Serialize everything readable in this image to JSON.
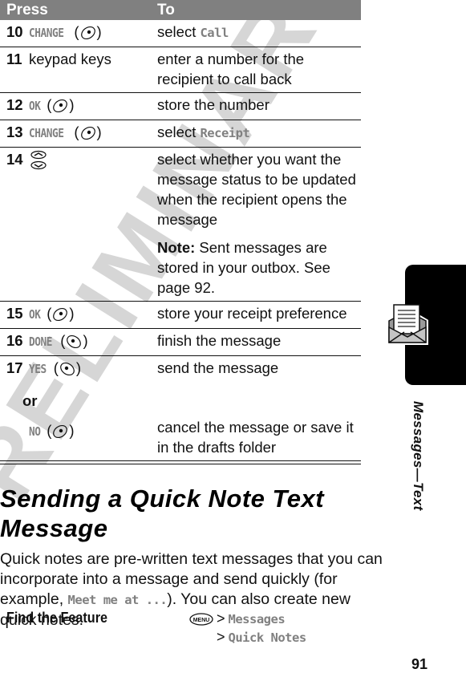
{
  "watermark": "PRELIMINARY",
  "table": {
    "headers": {
      "press": "Press",
      "to": "To"
    },
    "rows": [
      {
        "num": "10",
        "key": "CHANGE",
        "softkey_icon": "right-soft-key-icon",
        "to": "select ",
        "to_term": "Call"
      },
      {
        "num": "11",
        "press_text": "keypad keys",
        "to": "enter a number for the recipient to call back"
      },
      {
        "num": "12",
        "key": "OK",
        "softkey_icon": "right-soft-key-icon",
        "to": "store the number"
      },
      {
        "num": "13",
        "key": "CHANGE",
        "softkey_icon": "right-soft-key-icon",
        "to": "select ",
        "to_term": "Receipt"
      },
      {
        "num": "14",
        "press_icon": "scroll-up-down-icon",
        "to": "select whether you want the message status to be updated when the recipient opens the message",
        "note_label": "Note:",
        "note_text": " Sent messages are stored in your outbox. See page 92."
      },
      {
        "num": "15",
        "key": "OK",
        "softkey_icon": "right-soft-key-icon",
        "to": "store your receipt preference"
      },
      {
        "num": "16",
        "key": "DONE",
        "softkey_icon": "left-soft-key-icon",
        "to": "finish the message"
      },
      {
        "num": "17",
        "key": "YES",
        "softkey_icon": "left-soft-key-icon",
        "to": "send the message",
        "or_label": "or",
        "alt_key": "NO",
        "alt_softkey_icon": "right-soft-key-icon",
        "alt_to": "cancel the message or save it in the drafts folder"
      }
    ]
  },
  "section": {
    "title": "Sending a Quick Note Text Message",
    "body_before": "Quick notes are pre-written text messages that you can incorporate into a message and send quickly (for example, ",
    "body_term": "Meet me at ...",
    "body_after": "). You can also create new quick notes."
  },
  "find_feature": {
    "label": "Find the Feature",
    "menu_key": "MENU",
    "separator": ">",
    "path": [
      "Messages",
      "Quick Notes"
    ]
  },
  "side_tab": {
    "icon": "envelope-letter-icon",
    "label": "Messages—Text"
  },
  "page_number": "91"
}
